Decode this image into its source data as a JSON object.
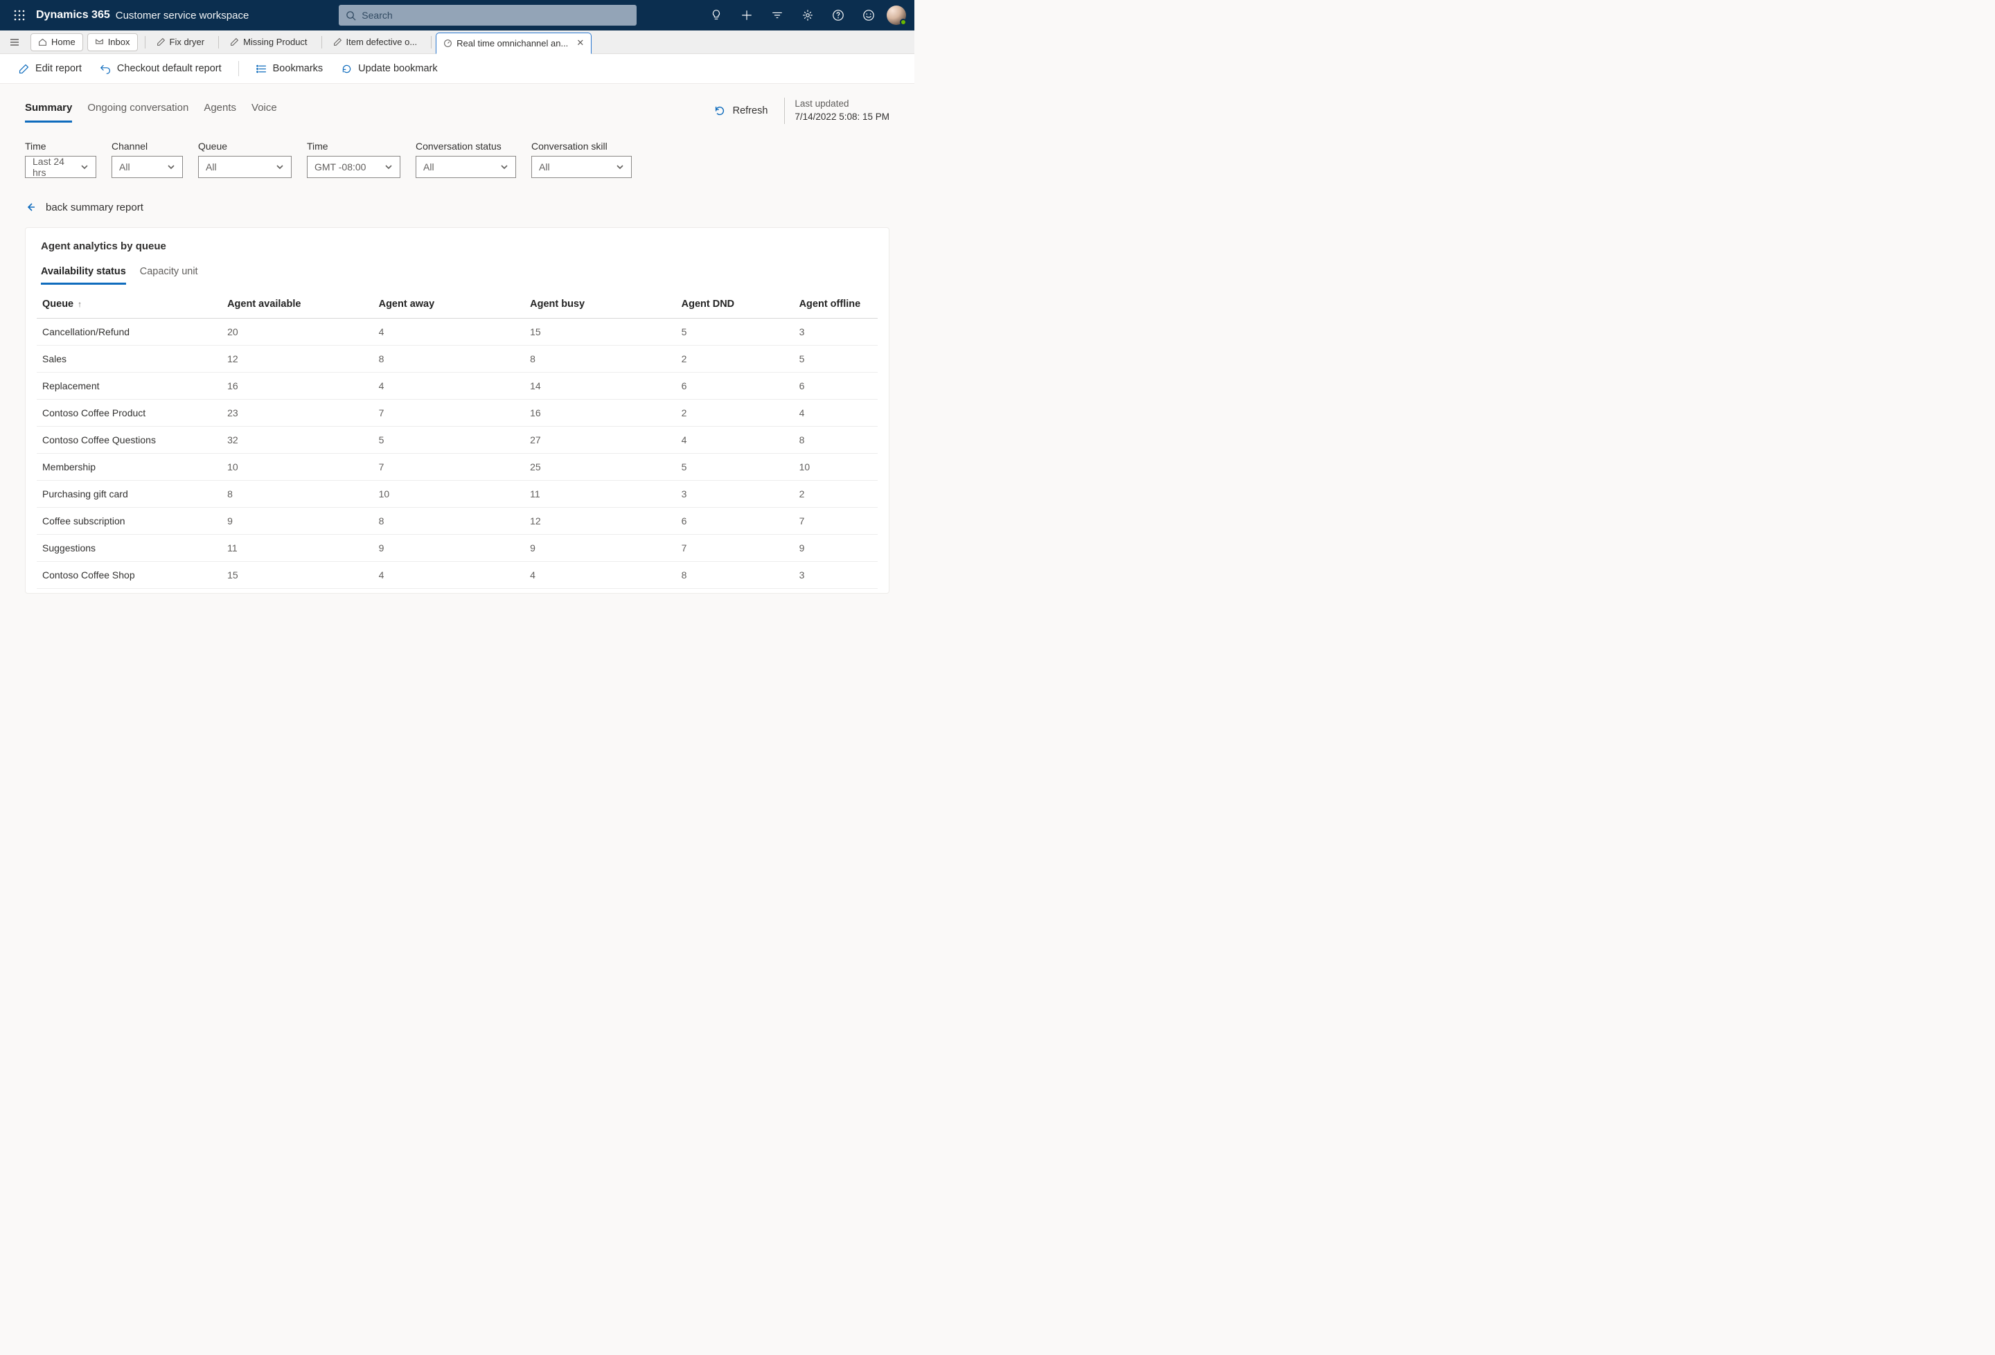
{
  "header": {
    "brand": "Dynamics 365",
    "brand_sub": "Customer service workspace",
    "search_placeholder": "Search"
  },
  "tabs": {
    "home": "Home",
    "inbox": "Inbox",
    "items": [
      "Fix dryer",
      "Missing Product",
      "Item defective o...",
      "Real time omnichannel an..."
    ]
  },
  "toolbar": {
    "edit": "Edit report",
    "checkout": "Checkout default report",
    "bookmarks": "Bookmarks",
    "update": "Update bookmark"
  },
  "pagetabs": [
    "Summary",
    "Ongoing conversation",
    "Agents",
    "Voice"
  ],
  "refresh_label": "Refresh",
  "last_updated_label": "Last updated",
  "last_updated_value": "7/14/2022 5:08: 15 PM",
  "filters": {
    "time": {
      "label": "Time",
      "value": "Last 24 hrs"
    },
    "channel": {
      "label": "Channel",
      "value": "All"
    },
    "queue": {
      "label": "Queue",
      "value": "All"
    },
    "tz": {
      "label": "Time",
      "value": "GMT -08:00"
    },
    "status": {
      "label": "Conversation status",
      "value": "All"
    },
    "skill": {
      "label": "Conversation skill",
      "value": "All"
    }
  },
  "back_label": "back summary report",
  "card_title": "Agent analytics by queue",
  "subtabs": [
    "Availability status",
    "Capacity unit"
  ],
  "table": {
    "columns": [
      "Queue",
      "Agent available",
      "Agent away",
      "Agent busy",
      "Agent DND",
      "Agent offline"
    ],
    "rows": [
      {
        "q": "Cancellation/Refund",
        "available": 20,
        "away": 4,
        "busy": 15,
        "dnd": 5,
        "offline": 3
      },
      {
        "q": "Sales",
        "available": 12,
        "away": 8,
        "busy": 8,
        "dnd": 2,
        "offline": 5
      },
      {
        "q": "Replacement",
        "available": 16,
        "away": 4,
        "busy": 14,
        "dnd": 6,
        "offline": 6
      },
      {
        "q": "Contoso Coffee Product",
        "available": 23,
        "away": 7,
        "busy": 16,
        "dnd": 2,
        "offline": 4
      },
      {
        "q": "Contoso Coffee Questions",
        "available": 32,
        "away": 5,
        "busy": 27,
        "dnd": 4,
        "offline": 8
      },
      {
        "q": "Membership",
        "available": 10,
        "away": 7,
        "busy": 25,
        "dnd": 5,
        "offline": 10
      },
      {
        "q": "Purchasing gift card",
        "available": 8,
        "away": 10,
        "busy": 11,
        "dnd": 3,
        "offline": 2
      },
      {
        "q": "Coffee subscription",
        "available": 9,
        "away": 8,
        "busy": 12,
        "dnd": 6,
        "offline": 7
      },
      {
        "q": "Suggestions",
        "available": 11,
        "away": 9,
        "busy": 9,
        "dnd": 7,
        "offline": 9
      },
      {
        "q": "Contoso Coffee Shop",
        "available": 15,
        "away": 4,
        "busy": 4,
        "dnd": 8,
        "offline": 3
      }
    ]
  }
}
